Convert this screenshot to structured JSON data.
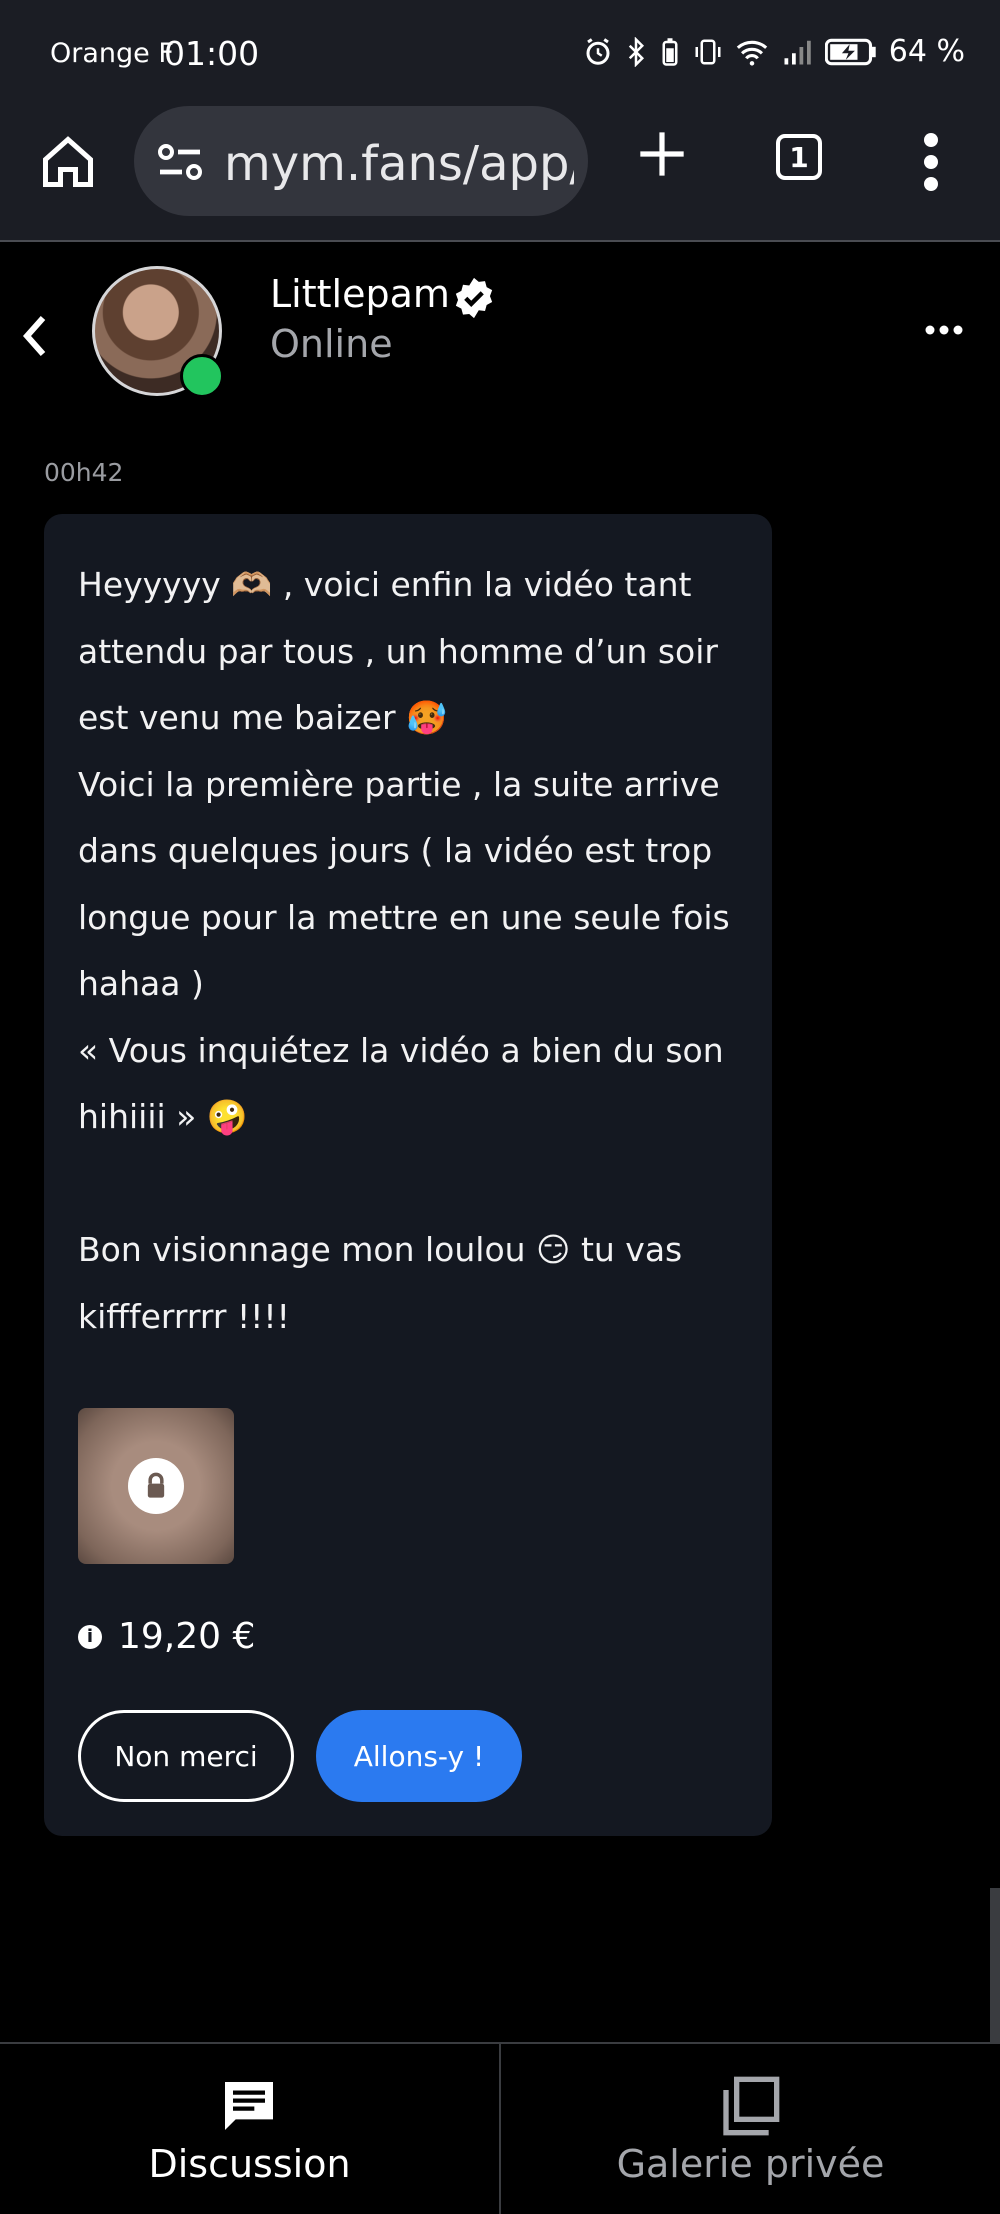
{
  "status_bar": {
    "carrier": "Orange F",
    "time": "01:00",
    "battery": "64 %",
    "icons": [
      "alarm-icon",
      "bluetooth-icon",
      "battery-saver-icon",
      "vibrate-icon",
      "wifi-icon",
      "signal-icon",
      "battery-charging-icon"
    ]
  },
  "browser": {
    "url": "mym.fans/app/",
    "tab_count": "1"
  },
  "chat_header": {
    "name": "Littlepam",
    "status": "Online",
    "verified": true
  },
  "message": {
    "timestamp": "00h42",
    "text": "Heyyyyy 🫶🏼 , voici enfin la vidéo tant attendu par tous , un homme d’un soir est venu me baizer 🥵\nVoici la première partie , la suite arrive dans quelques jours ( la vidéo est trop longue pour la mettre en une seule fois hahaa )\n« Vous inquiétez la vidéo a bien du son hihiiii » 🤪\n\nBon visionnage mon loulou 😏 tu vas kiffferrrrr !!!!",
    "price": "19,20 €",
    "decline_label": "Non merci",
    "accept_label": "Allons-y !"
  },
  "bottom_nav": {
    "discussion_label": "Discussion",
    "gallery_label": "Galerie privée"
  },
  "colors": {
    "accent": "#2b7af0",
    "online": "#22c55e",
    "bubble": "#141821"
  }
}
